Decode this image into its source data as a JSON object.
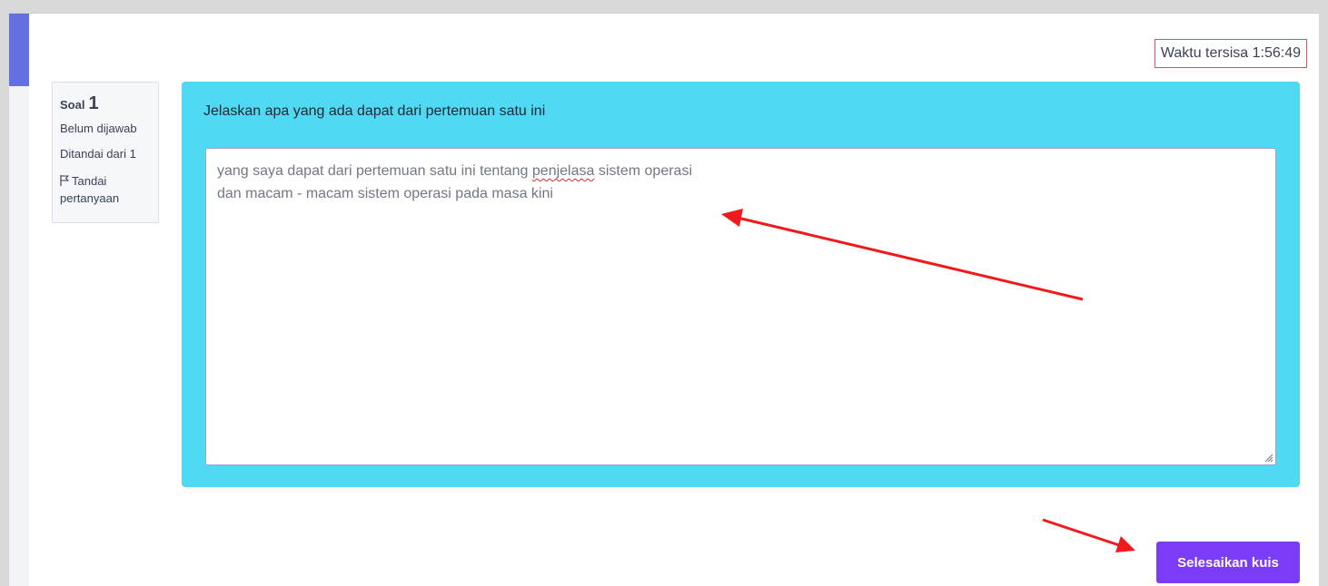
{
  "timer": {
    "label": "Waktu tersisa 1:56:49"
  },
  "question_info": {
    "soal_label": "Soal",
    "soal_number": "1",
    "status": "Belum dijawab",
    "marks": "Ditandai dari 1",
    "flag_label": "Tandai pertanyaan"
  },
  "question": {
    "text": "Jelaskan apa yang ada dapat dari pertemuan satu ini",
    "answer_line1_before": "yang saya dapat dari pertemuan satu ini tentang ",
    "answer_misspelled": "penjelasa",
    "answer_line1_after": " sistem operasi",
    "answer_line2": "dan macam - macam sistem operasi pada masa kini"
  },
  "actions": {
    "finish_label": "Selesaikan kuis"
  },
  "colors": {
    "accent": "#6470e0",
    "panel": "#4fd9f2",
    "button": "#7a3cf5",
    "annotation_arrow": "#f0191c",
    "timer_border": "#e34a64"
  },
  "icons": [
    "flag-icon",
    "resize-grip-icon",
    "annotation-arrow"
  ]
}
